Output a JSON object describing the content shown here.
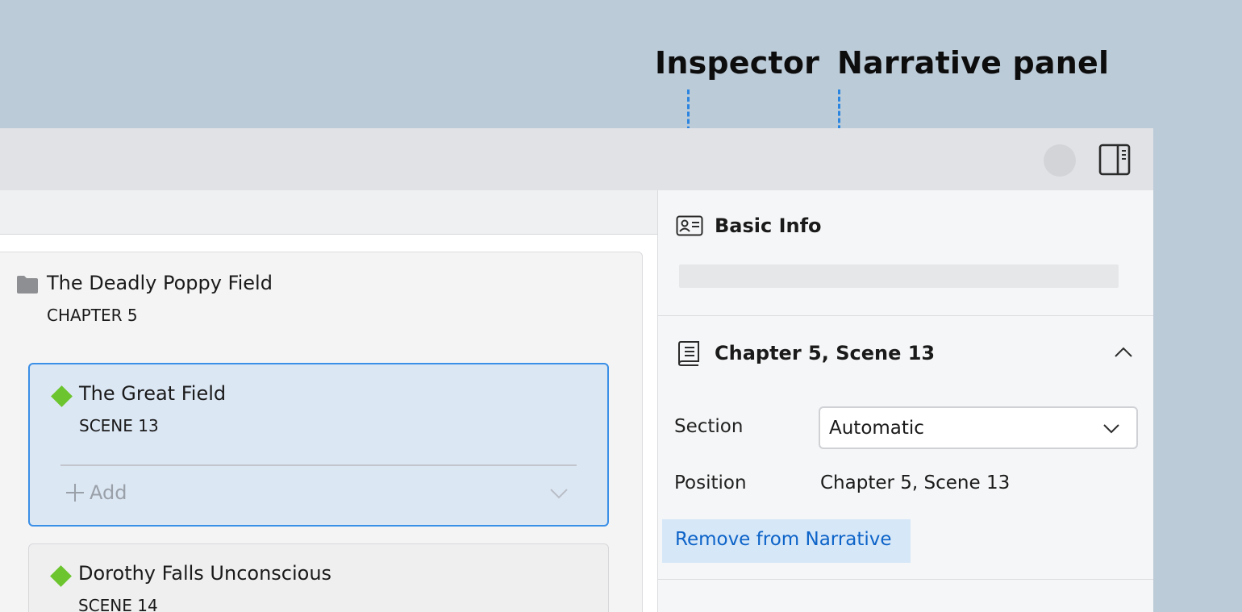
{
  "callouts": {
    "inspector": "Inspector",
    "narrative_panel": "Narrative panel"
  },
  "toolbar": {
    "icons": [
      "avatar",
      "panel-toggle-icon"
    ]
  },
  "outline": {
    "chapter": {
      "title": "The Deadly Poppy Field",
      "subtitle": "CHAPTER 5",
      "icon": "folder-icon"
    },
    "scenes": [
      {
        "title": "The Great Field",
        "subtitle": "SCENE 13",
        "selected": true,
        "add_label": "Add",
        "marker_color": "#6cc52e"
      },
      {
        "title": "Dorothy Falls Unconscious",
        "subtitle": "SCENE 14",
        "selected": false,
        "marker_color": "#6cc52e"
      }
    ]
  },
  "inspector": {
    "basic_info": {
      "title": "Basic Info",
      "icon": "id-card-icon"
    },
    "narrative": {
      "title": "Chapter 5, Scene 13",
      "icon": "book-icon",
      "section_label": "Section",
      "section_value": "Automatic",
      "position_label": "Position",
      "position_value": "Chapter 5, Scene 13",
      "remove_label": "Remove from Narrative"
    }
  },
  "colors": {
    "accent": "#3a8fe6",
    "link": "#0c63c8",
    "callout_line": "#2a85e0",
    "scene_marker": "#6cc52e",
    "selected_bg": "#dce7f4"
  }
}
